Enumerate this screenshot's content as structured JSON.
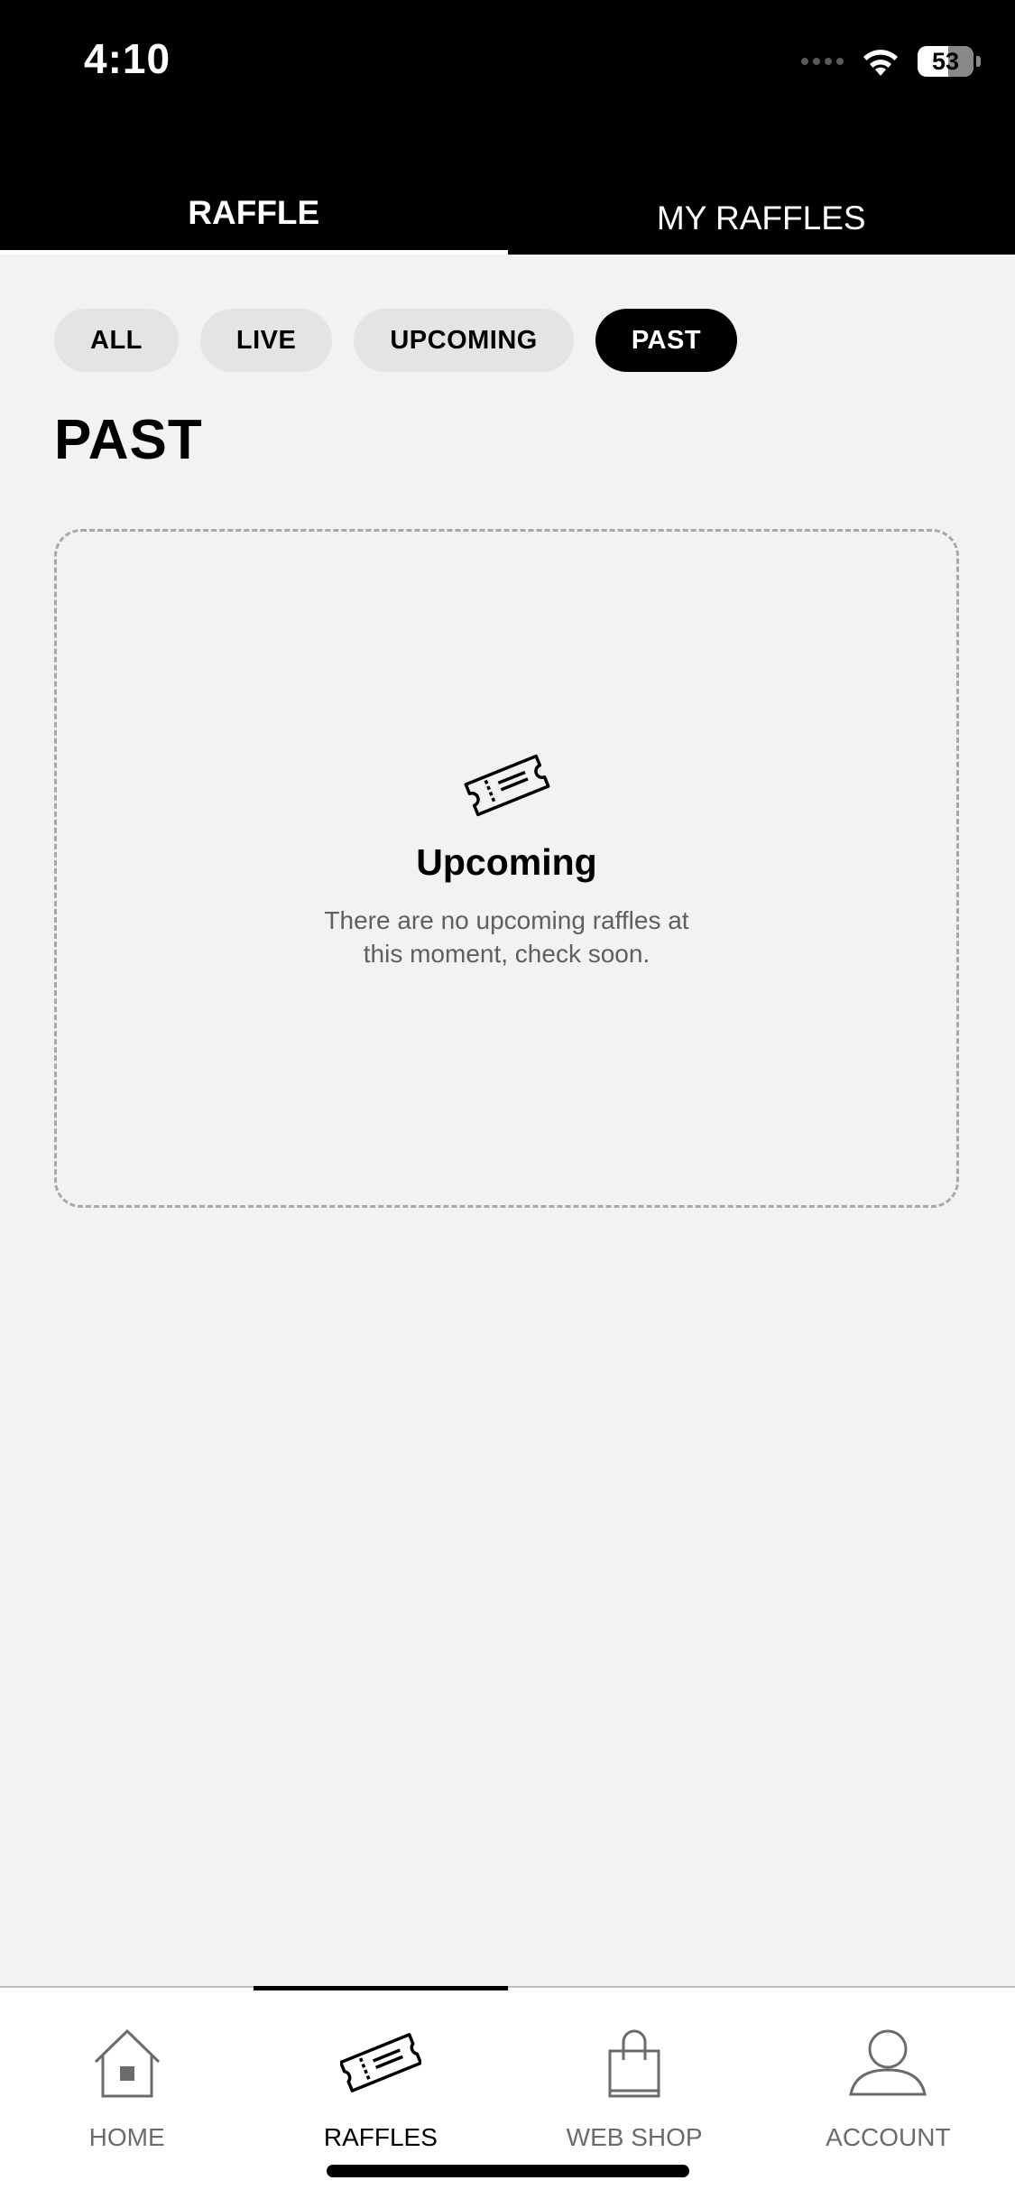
{
  "status_bar": {
    "time": "4:10",
    "battery": "53",
    "icons": [
      "signal-icon",
      "wifi-icon",
      "battery-icon"
    ]
  },
  "tabs": [
    {
      "label": "RAFFLE",
      "active": true
    },
    {
      "label": "MY RAFFLES",
      "active": false
    }
  ],
  "filters": [
    {
      "label": "ALL",
      "selected": false
    },
    {
      "label": "LIVE",
      "selected": false
    },
    {
      "label": "UPCOMING",
      "selected": false
    },
    {
      "label": "PAST",
      "selected": true
    }
  ],
  "section": {
    "title": "PAST"
  },
  "empty_state": {
    "icon": "ticket-icon",
    "title": "Upcoming",
    "message": "There are no upcoming raffles at this moment, check soon."
  },
  "bottom_nav": [
    {
      "label": "HOME",
      "icon": "home-icon",
      "active": false
    },
    {
      "label": "RAFFLES",
      "icon": "ticket-icon",
      "active": true
    },
    {
      "label": "WEB SHOP",
      "icon": "shopping-bag-icon",
      "active": false
    },
    {
      "label": "ACCOUNT",
      "icon": "user-icon",
      "active": false
    }
  ],
  "colors": {
    "header_bg": "#000000",
    "page_bg": "#f2f2f2",
    "chip_bg": "#e4e4e4",
    "chip_selected_bg": "#000000",
    "nav_bg": "#ffffff"
  }
}
